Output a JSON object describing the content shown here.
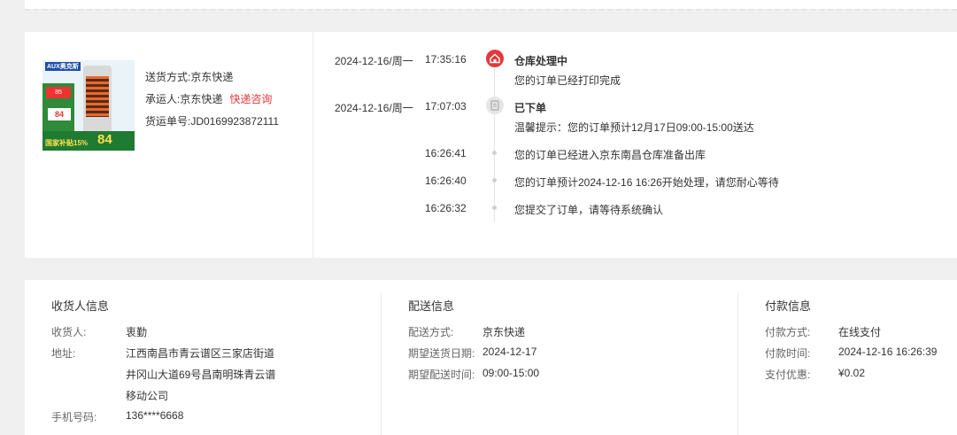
{
  "product": {
    "thumbnail_brand": "AUX奥克斯",
    "thumbnail_badge_top": "85",
    "thumbnail_badge_price": "84",
    "thumbnail_subsidy": "国家补贴15%",
    "thumbnail_price": "84"
  },
  "shipping": {
    "method_label": "送货方式:",
    "method_value": "京东快递",
    "carrier_label": "承运人:",
    "carrier_value": "京东快递",
    "carrier_link": "快递咨询",
    "tracking_label": "货运单号:",
    "tracking_value": "JD0169923872111"
  },
  "timeline": [
    {
      "date": "2024-12-16/周一",
      "time": "17:35:16",
      "title": "仓库处理中",
      "text": "您的订单已经打印完成",
      "node": "warehouse-icon",
      "color": "#e4393c"
    },
    {
      "date": "2024-12-16/周一",
      "time": "17:07:03",
      "title": "已下单",
      "text": "温馨提示：您的订单预计12月17日09:00-15:00送达",
      "node": "order-icon",
      "color": "#e6e6e6"
    },
    {
      "time": "16:26:41",
      "text": "您的订单已经进入京东南昌仓库准备出库"
    },
    {
      "time": "16:26:40",
      "text": "您的订单预计2024-12-16 16:26开始处理，请您耐心等待"
    },
    {
      "time": "16:26:32",
      "text": "您提交了订单，请等待系统确认"
    }
  ],
  "receiver": {
    "title": "收货人信息",
    "name_label": "收货人:",
    "name_value": "衷勤",
    "address_label": "地址:",
    "address_line1": "江西南昌市青云谱区三家店街道",
    "address_line2": "井冈山大道69号昌南明珠青云谱",
    "address_line3": "移动公司",
    "phone_label": "手机号码:",
    "phone_value": "136****6668"
  },
  "delivery": {
    "title": "配送信息",
    "method_label": "配送方式:",
    "method_value": "京东快递",
    "date_label": "期望送货日期:",
    "date_value": "2024-12-17",
    "time_label": "期望配送时间:",
    "time_value": "09:00-15:00"
  },
  "payment": {
    "title": "付款信息",
    "method_label": "付款方式:",
    "method_value": "在线支付",
    "time_label": "付款时间:",
    "time_value": "2024-12-16 16:26:39",
    "discount_label": "支付优惠:",
    "discount_value": "¥0.02"
  }
}
